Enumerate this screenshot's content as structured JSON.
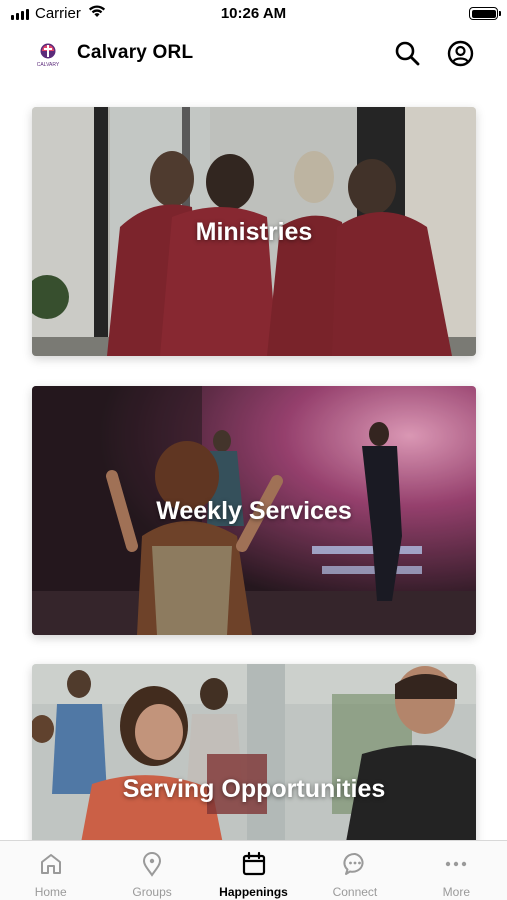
{
  "status_bar": {
    "carrier": "Carrier",
    "time": "10:26 AM"
  },
  "header": {
    "title": "Calvary ORL",
    "logo_text": "CALVARY",
    "icons": [
      "search-icon",
      "profile-icon"
    ]
  },
  "cards": [
    {
      "label": "Ministries"
    },
    {
      "label": "Weekly Services"
    },
    {
      "label": "Serving Opportunities"
    }
  ],
  "tab_bar": {
    "active": "Happenings",
    "tabs": [
      {
        "label": "Home",
        "icon": "home-icon"
      },
      {
        "label": "Groups",
        "icon": "location-pin-icon"
      },
      {
        "label": "Happenings",
        "icon": "calendar-icon"
      },
      {
        "label": "Connect",
        "icon": "chat-bubble-icon"
      },
      {
        "label": "More",
        "icon": "more-dots-icon"
      }
    ]
  },
  "colors": {
    "accent": "#000000",
    "inactive_tab": "#9a9a9a",
    "shirt_red": "#8e2a33"
  }
}
